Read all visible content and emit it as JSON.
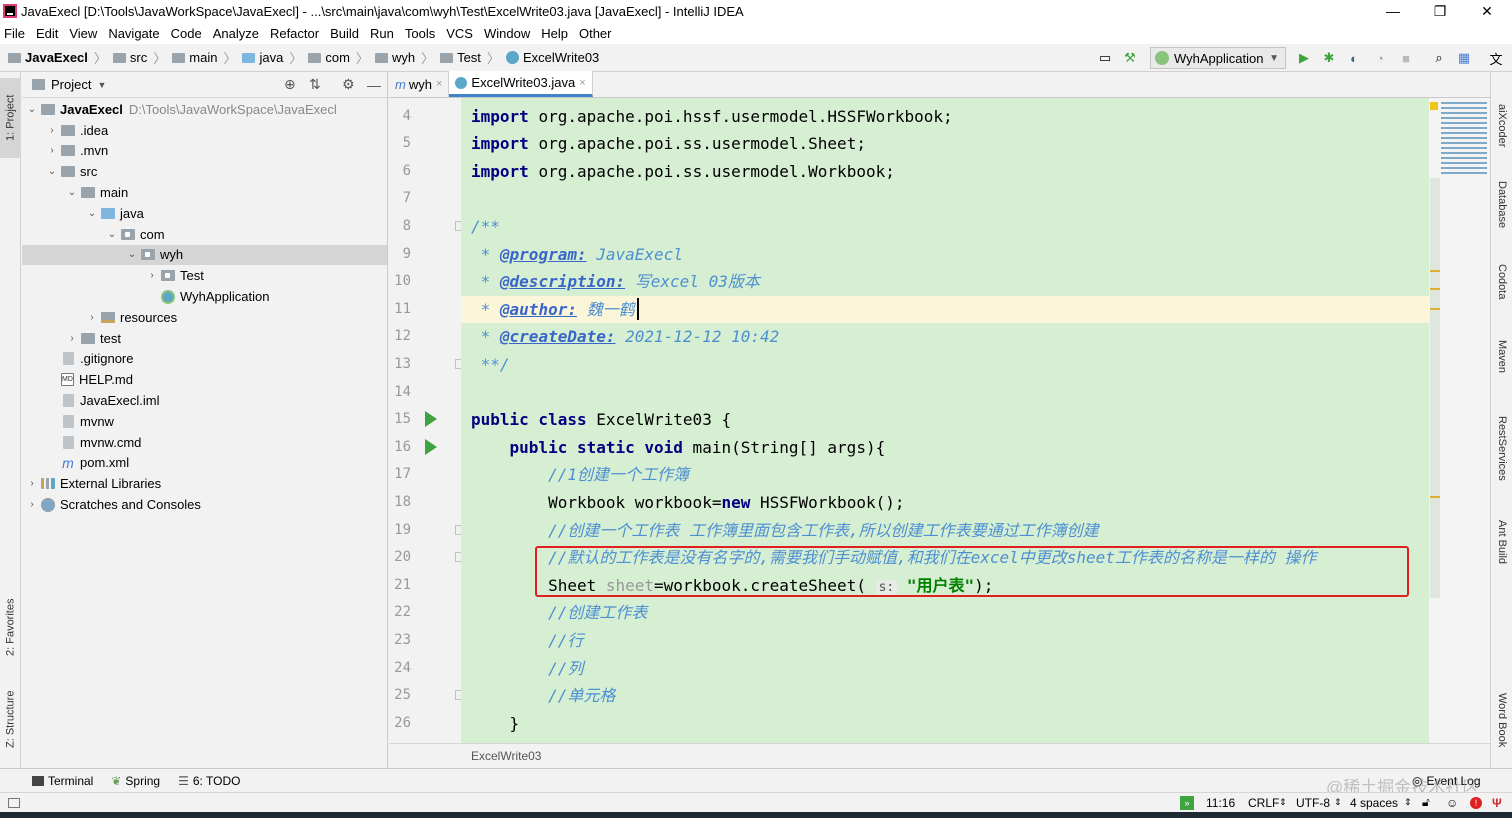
{
  "window": {
    "title": "JavaExecl [D:\\Tools\\JavaWorkSpace\\JavaExecl] - ...\\src\\main\\java\\com\\wyh\\Test\\ExcelWrite03.java [JavaExecl] - IntelliJ IDEA",
    "controls": [
      "—",
      "❐",
      "✕"
    ]
  },
  "menu": [
    "File",
    "Edit",
    "View",
    "Navigate",
    "Code",
    "Analyze",
    "Refactor",
    "Build",
    "Run",
    "Tools",
    "VCS",
    "Window",
    "Help",
    "Other"
  ],
  "navbar": {
    "crumbs": [
      "JavaExecl",
      "src",
      "main",
      "java",
      "com",
      "wyh",
      "Test",
      "ExcelWrite03"
    ],
    "run_config": "WyhApplication"
  },
  "left_tool_windows": [
    "1: Project",
    "2: Favorites",
    "Z: Structure"
  ],
  "project_panel": {
    "title": "Project",
    "tree": [
      {
        "label": "JavaExecl",
        "path": "D:\\Tools\\JavaWorkSpace\\JavaExecl",
        "level": 0,
        "arrow": "⌄",
        "icon": "folder",
        "bold": true
      },
      {
        "label": ".idea",
        "level": 1,
        "arrow": "›",
        "icon": "folder"
      },
      {
        "label": ".mvn",
        "level": 1,
        "arrow": "›",
        "icon": "folder"
      },
      {
        "label": "src",
        "level": 1,
        "arrow": "⌄",
        "icon": "folder"
      },
      {
        "label": "main",
        "level": 2,
        "arrow": "⌄",
        "icon": "folder"
      },
      {
        "label": "java",
        "level": 3,
        "arrow": "⌄",
        "icon": "src"
      },
      {
        "label": "com",
        "level": 4,
        "arrow": "⌄",
        "icon": "pkg"
      },
      {
        "label": "wyh",
        "level": 5,
        "arrow": "⌄",
        "icon": "pkg",
        "selected": true
      },
      {
        "label": "Test",
        "level": 6,
        "arrow": "›",
        "icon": "pkg"
      },
      {
        "label": "WyhApplication",
        "level": 6,
        "arrow": "",
        "icon": "cls"
      },
      {
        "label": "resources",
        "level": 3,
        "arrow": "›",
        "icon": "res"
      },
      {
        "label": "test",
        "level": 2,
        "arrow": "›",
        "icon": "folder"
      },
      {
        "label": ".gitignore",
        "level": 1,
        "arrow": "",
        "icon": "file"
      },
      {
        "label": "HELP.md",
        "level": 1,
        "arrow": "",
        "icon": "md"
      },
      {
        "label": "JavaExecl.iml",
        "level": 1,
        "arrow": "",
        "icon": "file"
      },
      {
        "label": "mvnw",
        "level": 1,
        "arrow": "",
        "icon": "file"
      },
      {
        "label": "mvnw.cmd",
        "level": 1,
        "arrow": "",
        "icon": "file"
      },
      {
        "label": "pom.xml",
        "level": 1,
        "arrow": "",
        "icon": "mvn"
      },
      {
        "label": "External Libraries",
        "level": 0,
        "arrow": "›",
        "icon": "lib"
      },
      {
        "label": "Scratches and Consoles",
        "level": 0,
        "arrow": "›",
        "icon": "scr"
      }
    ]
  },
  "editor_tabs": [
    {
      "label": "wyh",
      "icon": "m",
      "active": false
    },
    {
      "label": "ExcelWrite03.java",
      "icon": "C",
      "active": true
    }
  ],
  "code": {
    "lines": [
      {
        "n": "4",
        "tokens": [
          [
            "kw",
            "import"
          ],
          [
            "",
            "org.apache.poi.hssf.usermodel.HSSFWorkbook;"
          ]
        ]
      },
      {
        "n": "5",
        "tokens": [
          [
            "kw",
            "import"
          ],
          [
            "",
            "org.apache.poi.ss.usermodel.Sheet;"
          ]
        ]
      },
      {
        "n": "6",
        "tokens": [
          [
            "kw",
            "import"
          ],
          [
            "",
            "org.apache.poi.ss.usermodel.Workbook;"
          ]
        ]
      },
      {
        "n": "7",
        "tokens": []
      },
      {
        "n": "8",
        "tokens": [
          [
            "cm",
            "/**"
          ]
        ]
      },
      {
        "n": "9",
        "tokens": [
          [
            "cm",
            " * "
          ],
          [
            "tag",
            "@program:"
          ],
          [
            "cm",
            " JavaExecl"
          ]
        ]
      },
      {
        "n": "10",
        "tokens": [
          [
            "cm",
            " * "
          ],
          [
            "tag",
            "@description:"
          ],
          [
            "cm",
            " 写excel 03版本"
          ]
        ]
      },
      {
        "n": "11",
        "tokens": [
          [
            "cm",
            " * "
          ],
          [
            "tag",
            "@author:"
          ],
          [
            "cm",
            " 魏一鹤"
          ]
        ],
        "current": true
      },
      {
        "n": "12",
        "tokens": [
          [
            "cm",
            " * "
          ],
          [
            "tag",
            "@createDate:"
          ],
          [
            "cm",
            " 2021-12-12 10:42"
          ]
        ]
      },
      {
        "n": "13",
        "tokens": [
          [
            "cm",
            " **/"
          ]
        ]
      },
      {
        "n": "14",
        "tokens": []
      },
      {
        "n": "15",
        "tokens": [
          [
            "kw",
            "public class"
          ],
          [
            "",
            " ExcelWrite03 {"
          ]
        ]
      },
      {
        "n": "16",
        "tokens": [
          [
            "",
            "    "
          ],
          [
            "kw",
            "public static void"
          ],
          [
            "",
            " main(String[] args){"
          ]
        ]
      },
      {
        "n": "17",
        "tokens": [
          [
            "",
            "        "
          ],
          [
            "cm",
            "//1创建一个工作簿"
          ]
        ]
      },
      {
        "n": "18",
        "tokens": [
          [
            "",
            "        Workbook workbook="
          ],
          [
            "kw",
            "new"
          ],
          [
            "",
            " HSSFWorkbook();"
          ]
        ]
      },
      {
        "n": "19",
        "tokens": [
          [
            "",
            "        "
          ],
          [
            "cm",
            "//创建一个工作表 工作簿里面包含工作表,所以创建工作表要通过工作簿创建"
          ]
        ]
      },
      {
        "n": "20",
        "tokens": [
          [
            "",
            "        "
          ],
          [
            "cm",
            "//默认的工作表是没有名字的,需要我们手动赋值,和我们在excel中更改sheet工作表的名称是一样的 操作"
          ]
        ]
      },
      {
        "n": "21",
        "tokens": [
          [
            "",
            "        Sheet "
          ],
          [
            "gv",
            "sheet"
          ],
          [
            "",
            "=workbook.createSheet( "
          ],
          [
            "hint",
            "s:"
          ],
          [
            "str",
            " \"用户表\""
          ],
          [
            "",
            ");"
          ]
        ]
      },
      {
        "n": "22",
        "tokens": [
          [
            "",
            "        "
          ],
          [
            "cm",
            "//创建工作表"
          ]
        ]
      },
      {
        "n": "23",
        "tokens": [
          [
            "",
            "        "
          ],
          [
            "cm",
            "//行"
          ]
        ]
      },
      {
        "n": "24",
        "tokens": [
          [
            "",
            "        "
          ],
          [
            "cm",
            "//列"
          ]
        ]
      },
      {
        "n": "25",
        "tokens": [
          [
            "",
            "        "
          ],
          [
            "cm",
            "//单元格"
          ]
        ]
      },
      {
        "n": "26",
        "tokens": [
          [
            "",
            "    }"
          ]
        ]
      }
    ]
  },
  "editor_breadcrumb": "ExcelWrite03",
  "right_tool_windows": [
    "aiXcoder",
    "Database",
    "Codota",
    "Maven",
    "RestServices",
    "Ant Build",
    "Word Book"
  ],
  "bottom_tools": [
    {
      "label": "Terminal",
      "icon": "terminal-icon"
    },
    {
      "label": "Spring",
      "icon": "spring-icon"
    },
    {
      "label": "6: TODO",
      "icon": "todo-icon"
    }
  ],
  "event_log": "Event Log",
  "watermark": "@稀土掘金技术社区",
  "status": {
    "position": "11:16",
    "line_sep": "CRLF",
    "encoding": "UTF-8",
    "indent": "4 spaces"
  },
  "colors": {
    "editor_bg": "#d6efd3",
    "keyword": "#000080",
    "comment": "#4d8fd1",
    "string": "#008000",
    "highlight_box": "#e02020",
    "run_green": "#3fa43f"
  }
}
